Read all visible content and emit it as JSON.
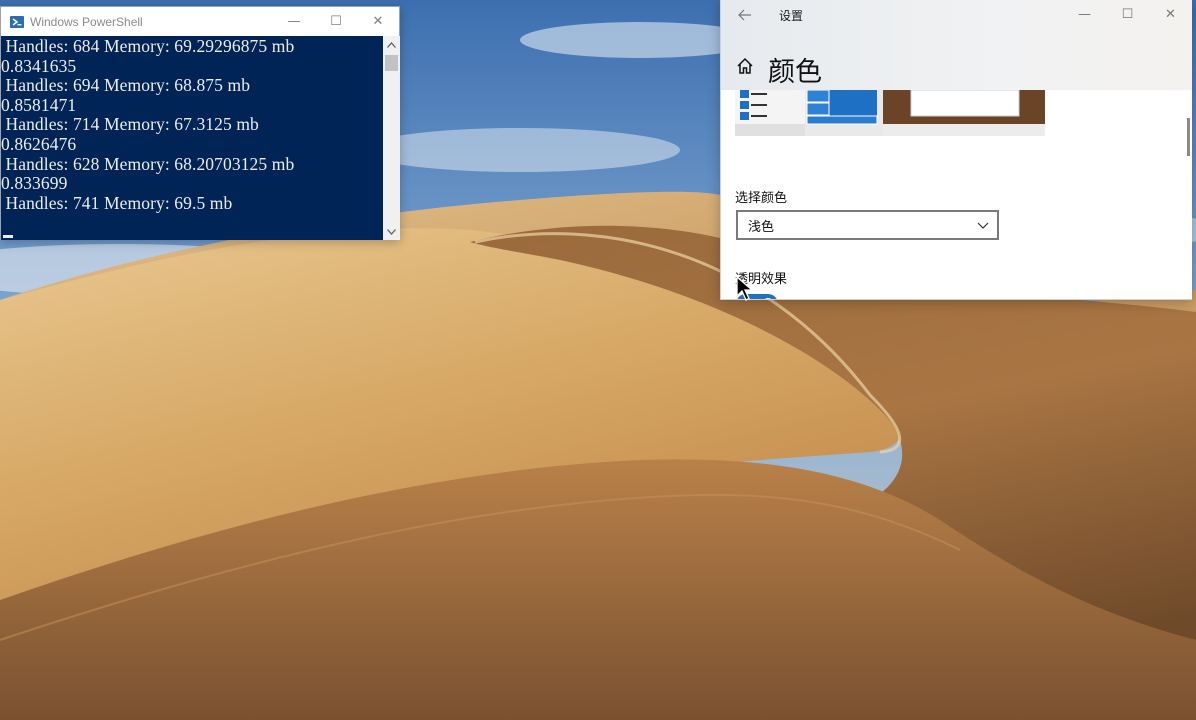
{
  "powershell": {
    "title": "Windows PowerShell",
    "lines": [
      " Handles: 684 Memory: 69.29296875 mb",
      "0.8341635",
      " Handles: 694 Memory: 68.875 mb",
      "0.8581471",
      " Handles: 714 Memory: 67.3125 mb",
      "0.8626476",
      " Handles: 628 Memory: 68.20703125 mb",
      "0.833699",
      " Handles: 741 Memory: 69.5 mb"
    ],
    "controls": {
      "minimize": "—",
      "maximize": "☐",
      "close": "✕"
    }
  },
  "settings": {
    "window_title": "设置",
    "page_title": "颜色",
    "choose_color_label": "选择颜色",
    "color_mode_value": "浅色",
    "transparency_label": "透明效果",
    "transparency_state": "开",
    "controls": {
      "minimize": "—",
      "maximize": "☐",
      "close": "✕"
    },
    "accent_color": "#1d70c4"
  },
  "icons": {
    "ps_app": "powershell-icon",
    "back": "back-arrow-icon",
    "home": "home-icon",
    "dropdown": "chevron-down-icon",
    "pointer": "mouse-pointer-icon"
  }
}
